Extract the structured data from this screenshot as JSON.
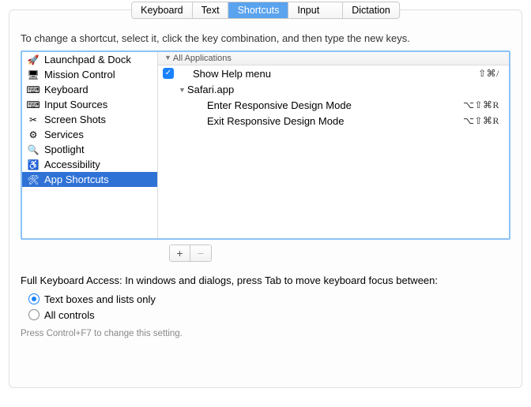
{
  "tabs": [
    {
      "label": "Keyboard"
    },
    {
      "label": "Text"
    },
    {
      "label": "Shortcuts",
      "selected": true
    },
    {
      "label": "Input Sources"
    },
    {
      "label": "Dictation"
    }
  ],
  "instruction": "To change a shortcut, select it, click the key combination, and then type the new keys.",
  "categories": [
    {
      "label": "Launchpad & Dock",
      "icon": "🚀"
    },
    {
      "label": "Mission Control",
      "icon": "🖥"
    },
    {
      "label": "Keyboard",
      "icon": "⌨"
    },
    {
      "label": "Input Sources",
      "icon": "⌨"
    },
    {
      "label": "Screen Shots",
      "icon": "✂"
    },
    {
      "label": "Services",
      "icon": "⚙"
    },
    {
      "label": "Spotlight",
      "icon": "🔍"
    },
    {
      "label": "Accessibility",
      "icon": "♿"
    },
    {
      "label": "App Shortcuts",
      "icon": "🛠",
      "selected": true
    }
  ],
  "header": {
    "title": "All Applications"
  },
  "entries": [
    {
      "label": "Show Help menu",
      "shortcut": "⇧⌘/",
      "checked": true,
      "indent": 1
    },
    {
      "label": "Safari.app",
      "group": true,
      "indent": 0
    },
    {
      "label": "Enter Responsive Design Mode",
      "shortcut": "⌥⇧⌘R",
      "indent": 2
    },
    {
      "label": "Exit Responsive Design Mode",
      "shortcut": "⌥⇧⌘R",
      "indent": 2
    }
  ],
  "buttons": {
    "add": "+",
    "remove": "−"
  },
  "fka_label": "Full Keyboard Access: In windows and dialogs, press Tab to move keyboard focus between:",
  "radio1": "Text boxes and lists only",
  "radio2": "All controls",
  "hint": "Press Control+F7 to change this setting."
}
